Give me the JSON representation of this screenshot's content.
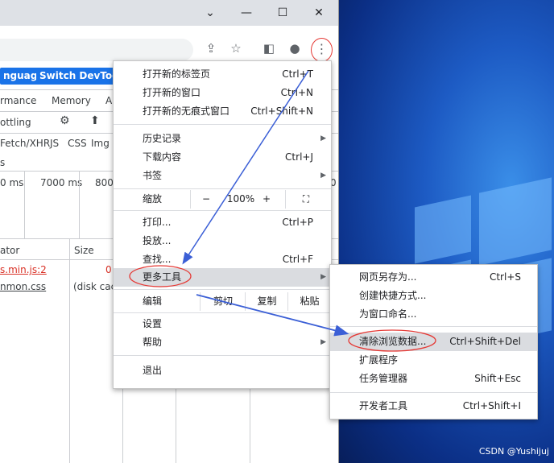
{
  "devtools": {
    "btn_language": "nguage",
    "btn_switch": "Switch DevTools",
    "tabs": [
      "rmance",
      "Memory",
      "A"
    ],
    "throttling": "ottling",
    "filters": [
      "Fetch/XHR",
      "JS",
      "CSS",
      "Img"
    ],
    "timeline": [
      "0 ms",
      "7000 ms",
      "800"
    ],
    "col_initiator": "ator",
    "col_size": "Size",
    "rows": [
      {
        "initiator": "s.min.js:2",
        "size": "0"
      },
      {
        "initiator": "nmon.css",
        "size": "(disk cac"
      }
    ],
    "misc_s": "s",
    "timeline_right": "0"
  },
  "main_menu": {
    "new_tab": {
      "label": "打开新的标签页",
      "shortcut": "Ctrl+T"
    },
    "new_window": {
      "label": "打开新的窗口",
      "shortcut": "Ctrl+N"
    },
    "new_incognito": {
      "label": "打开新的无痕式窗口",
      "shortcut": "Ctrl+Shift+N"
    },
    "history": {
      "label": "历史记录"
    },
    "downloads": {
      "label": "下载内容",
      "shortcut": "Ctrl+J"
    },
    "bookmarks": {
      "label": "书签"
    },
    "zoom": {
      "label": "缩放",
      "minus": "−",
      "value": "100%",
      "plus": "+",
      "fullscreen": "⛶"
    },
    "print": {
      "label": "打印...",
      "shortcut": "Ctrl+P"
    },
    "cast": {
      "label": "投放..."
    },
    "find": {
      "label": "查找...",
      "shortcut": "Ctrl+F"
    },
    "more_tools": {
      "label": "更多工具"
    },
    "edit": {
      "label": "编辑",
      "cut": "剪切",
      "copy": "复制",
      "paste": "粘贴"
    },
    "settings": {
      "label": "设置"
    },
    "help": {
      "label": "帮助"
    },
    "exit": {
      "label": "退出"
    }
  },
  "sub_menu": {
    "save_as": {
      "label": "网页另存为...",
      "shortcut": "Ctrl+S"
    },
    "create_shortcut": {
      "label": "创建快捷方式..."
    },
    "name_window": {
      "label": "为窗口命名..."
    },
    "clear_data": {
      "label": "清除浏览数据...",
      "shortcut": "Ctrl+Shift+Del"
    },
    "extensions": {
      "label": "扩展程序"
    },
    "task_manager": {
      "label": "任务管理器",
      "shortcut": "Shift+Esc"
    },
    "dev_tools": {
      "label": "开发者工具",
      "shortcut": "Ctrl+Shift+I"
    }
  },
  "watermark": "CSDN @Yushijuj",
  "colors": {
    "accent": "#1a73e8",
    "annotation_red": "#e53935",
    "annotation_arrow": "#3b5fd6",
    "highlight": "#dadce0"
  }
}
